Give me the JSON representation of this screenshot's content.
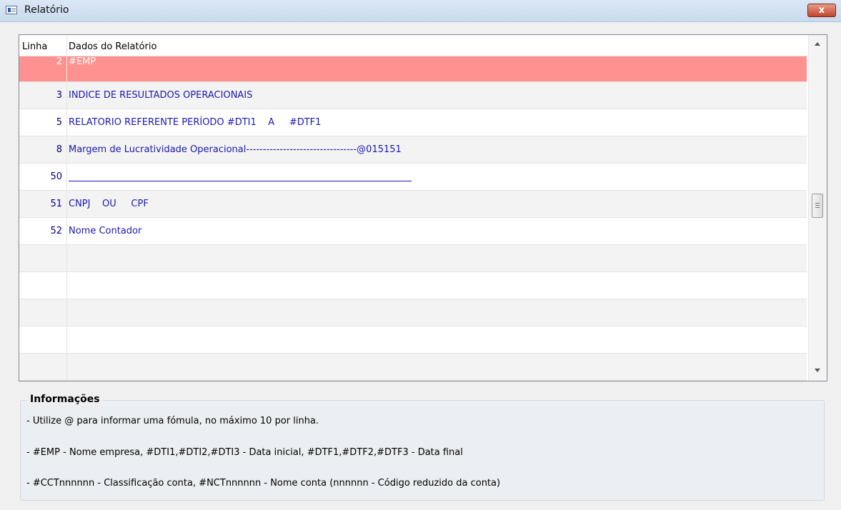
{
  "window": {
    "title": "Relatório",
    "close_label": "x"
  },
  "grid": {
    "columns": [
      "Linha",
      "Dados do Relatório"
    ],
    "rows": [
      {
        "line": "2",
        "data": "#EMP",
        "selected": true
      },
      {
        "line": "3",
        "data": "INDICE DE RESULTADOS OPERACIONAIS"
      },
      {
        "line": "5",
        "data": "RELATORIO REFERENTE PERÍODO #DTI1    A     #DTF1"
      },
      {
        "line": "8",
        "data": "Margem de Lucratividade Operacional---------------------------------@015151"
      },
      {
        "line": "50",
        "data": ""
      },
      {
        "line": "51",
        "data": "CNPJ    OU     CPF"
      },
      {
        "line": "52",
        "data": "Nome Contador"
      },
      {
        "line": "",
        "data": ""
      },
      {
        "line": "",
        "data": ""
      },
      {
        "line": "",
        "data": ""
      },
      {
        "line": "",
        "data": ""
      },
      {
        "line": "",
        "data": ""
      }
    ],
    "selected_color": "#ff9290",
    "text_color": "#1a1ab0"
  },
  "info": {
    "title": "Informações",
    "lines": [
      "- Utilize @ para informar uma fómula, no máximo 10 por linha.",
      "- #EMP - Nome empresa, #DTI1,#DTI2,#DTI3 - Data inicial, #DTF1,#DTF2,#DTF3 - Data final",
      "- #CCTnnnnnn - Classificação conta, #NCTnnnnnn - Nome conta (nnnnnn - Código reduzido da conta)"
    ]
  }
}
